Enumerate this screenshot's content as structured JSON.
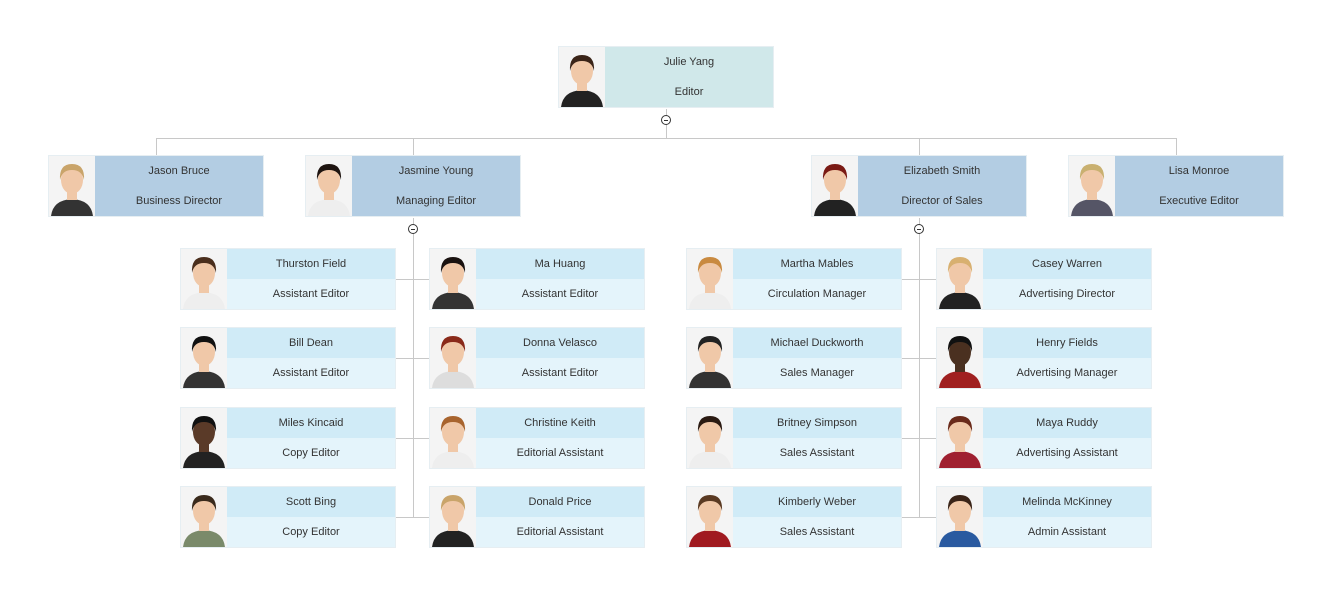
{
  "root": {
    "name": "Julie Yang",
    "title": "Editor",
    "hair": "#3a2418",
    "shirt": "#222"
  },
  "managers": [
    {
      "name": "Jason Bruce",
      "title": "Business Director",
      "hair": "#c9a46a",
      "shirt": "#333"
    },
    {
      "name": "Jasmine Young",
      "title": "Managing Editor",
      "hair": "#1e1410",
      "shirt": "#eee",
      "reports": [
        {
          "name": "Thurston Field",
          "title": "Assistant Editor",
          "hair": "#4a2e1c",
          "shirt": "#eee"
        },
        {
          "name": "Ma Huang",
          "title": "Assistant Editor",
          "hair": "#1a1210",
          "shirt": "#333"
        },
        {
          "name": "Bill Dean",
          "title": "Assistant Editor",
          "hair": "#111",
          "shirt": "#333"
        },
        {
          "name": "Donna Velasco",
          "title": "Assistant Editor",
          "hair": "#8a2a1a",
          "shirt": "#ddd"
        },
        {
          "name": "Miles Kincaid",
          "title": "Copy Editor",
          "hair": "#111",
          "shirt": "#222",
          "skin": "#5a3a28"
        },
        {
          "name": "Christine Keith",
          "title": "Editorial Assistant",
          "hair": "#a8642e",
          "shirt": "#eee"
        },
        {
          "name": "Scott Bing",
          "title": "Copy Editor",
          "hair": "#3a2a1c",
          "shirt": "#7a8a6a"
        },
        {
          "name": "Donald Price",
          "title": "Editorial Assistant",
          "hair": "#c9a46a",
          "shirt": "#222"
        }
      ]
    },
    {
      "name": "Elizabeth Smith",
      "title": "Director of Sales",
      "hair": "#7a1a14",
      "shirt": "#222",
      "reports": [
        {
          "name": "Martha Mables",
          "title": "Circulation Manager",
          "hair": "#c98a40",
          "shirt": "#eee"
        },
        {
          "name": "Casey Warren",
          "title": "Advertising Director",
          "hair": "#d8b070",
          "shirt": "#222"
        },
        {
          "name": "Michael Duckworth",
          "title": "Sales Manager",
          "hair": "#222",
          "shirt": "#333"
        },
        {
          "name": "Henry Fields",
          "title": "Advertising Manager",
          "hair": "#111",
          "shirt": "#a02020",
          "skin": "#4a3020"
        },
        {
          "name": "Britney Simpson",
          "title": "Sales Assistant",
          "hair": "#2a1a12",
          "shirt": "#eee"
        },
        {
          "name": "Maya Ruddy",
          "title": "Advertising Assistant",
          "hair": "#6a2a1a",
          "shirt": "#a02030"
        },
        {
          "name": "Kimberly Weber",
          "title": "Sales Assistant",
          "hair": "#5a3a22",
          "shirt": "#a01a20"
        },
        {
          "name": "Melinda McKinney",
          "title": "Admin Assistant",
          "hair": "#3a2418",
          "shirt": "#2a5aa0"
        }
      ]
    },
    {
      "name": "Lisa Monroe",
      "title": "Executive Editor",
      "hair": "#c9b070",
      "shirt": "#556"
    }
  ],
  "icons": {
    "collapse": "minus-circle-icon"
  }
}
